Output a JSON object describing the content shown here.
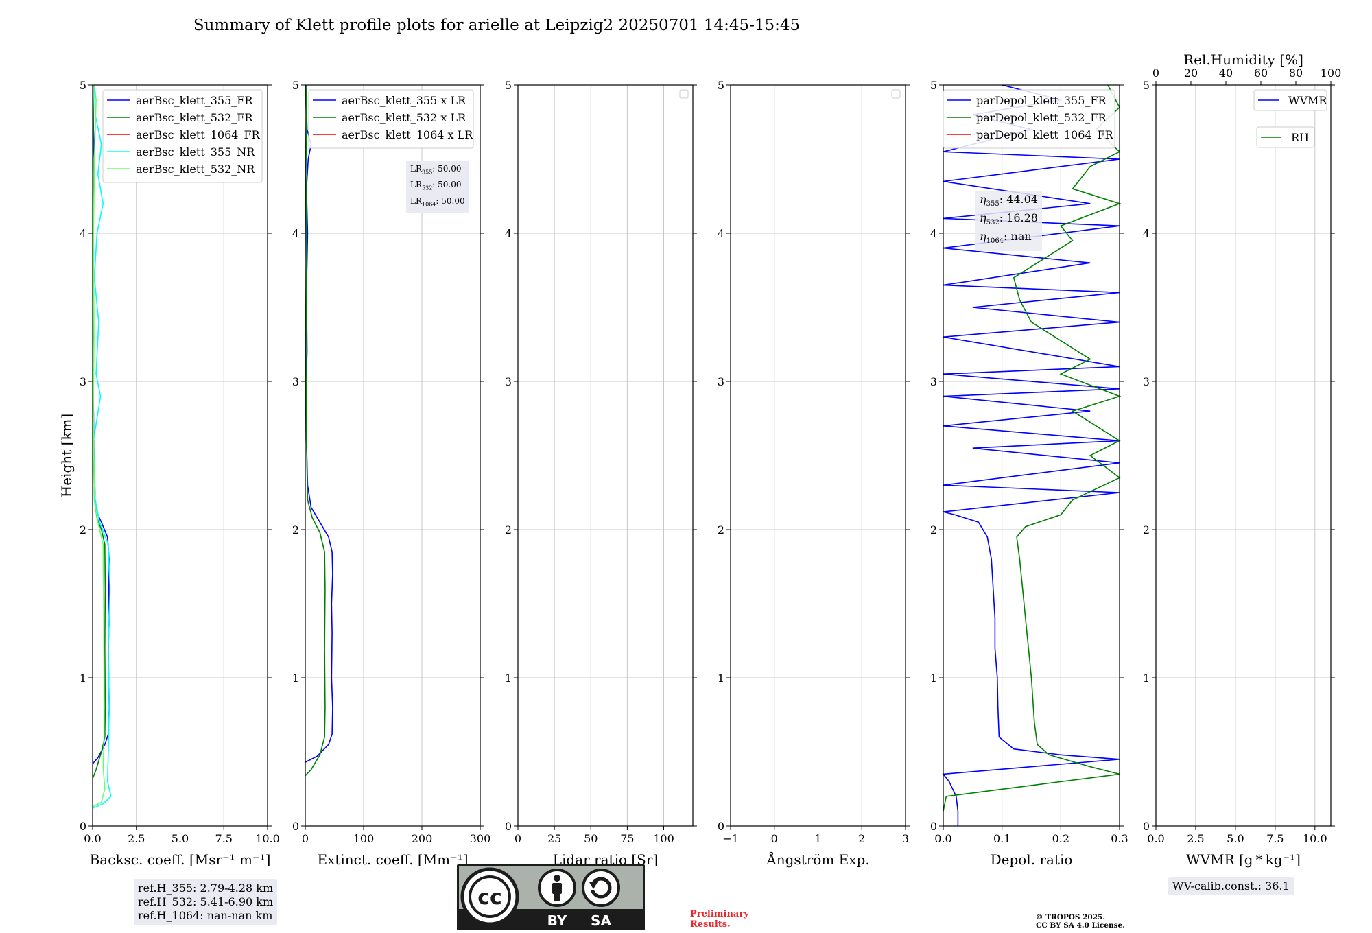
{
  "figure_title": "Summary of Klett profile plots for arielle at Leipzig2 20250701 14:45-15:45",
  "chart_data": [
    {
      "type": "line",
      "xlabel": "Backsc. coeff. [Msr⁻¹ m⁻¹]",
      "ylabel": "Height [km]",
      "xlim": [
        0,
        10
      ],
      "ylim": [
        0,
        5
      ],
      "xticks": [
        "0.0",
        "2.5",
        "5.0",
        "7.5",
        "10.0"
      ],
      "yticks": [
        "0",
        "1",
        "2",
        "3",
        "4",
        "5"
      ],
      "grid": true,
      "legend": "top-right",
      "series": [
        {
          "name": "aerBsc_klett_355_FR",
          "color": "#0000ff",
          "points": [
            [
              0.0,
              0.42
            ],
            [
              0.3,
              0.46
            ],
            [
              0.7,
              0.55
            ],
            [
              0.9,
              0.62
            ],
            [
              0.95,
              0.8
            ],
            [
              0.92,
              1.0
            ],
            [
              0.9,
              1.2
            ],
            [
              0.95,
              1.4
            ],
            [
              0.93,
              1.6
            ],
            [
              0.95,
              1.8
            ],
            [
              0.85,
              1.95
            ],
            [
              0.5,
              2.05
            ],
            [
              0.3,
              2.1
            ],
            [
              0.15,
              2.2
            ],
            [
              0.08,
              2.5
            ],
            [
              0.03,
              3.0
            ],
            [
              0.05,
              3.5
            ],
            [
              0.02,
              4.0
            ],
            [
              0.07,
              4.3
            ],
            [
              0.1,
              4.5
            ],
            [
              0.05,
              4.7
            ],
            [
              0.02,
              5.0
            ]
          ]
        },
        {
          "name": "aerBsc_klett_532_FR",
          "color": "#008000",
          "points": [
            [
              0.0,
              0.32
            ],
            [
              0.2,
              0.38
            ],
            [
              0.5,
              0.5
            ],
            [
              0.7,
              0.6
            ],
            [
              0.72,
              0.8
            ],
            [
              0.7,
              1.2
            ],
            [
              0.72,
              1.6
            ],
            [
              0.7,
              1.9
            ],
            [
              0.5,
              2.0
            ],
            [
              0.25,
              2.08
            ],
            [
              0.1,
              2.2
            ],
            [
              0.05,
              2.6
            ],
            [
              0.03,
              3.2
            ],
            [
              0.04,
              3.8
            ],
            [
              0.02,
              4.4
            ],
            [
              0.04,
              4.8
            ],
            [
              0.02,
              5.0
            ]
          ]
        },
        {
          "name": "aerBsc_klett_1064_FR",
          "color": "#ff0000",
          "points": []
        },
        {
          "name": "aerBsc_klett_355_NR",
          "color": "#00ffff",
          "points": [
            [
              0.0,
              0.12
            ],
            [
              0.6,
              0.15
            ],
            [
              1.05,
              0.2
            ],
            [
              0.85,
              0.3
            ],
            [
              0.9,
              0.5
            ],
            [
              0.95,
              0.8
            ],
            [
              0.9,
              1.2
            ],
            [
              1.0,
              1.6
            ],
            [
              0.9,
              1.9
            ],
            [
              0.4,
              2.05
            ],
            [
              0.15,
              2.2
            ],
            [
              0.05,
              2.6
            ],
            [
              0.45,
              2.9
            ],
            [
              0.2,
              3.05
            ],
            [
              0.35,
              3.4
            ],
            [
              0.1,
              3.7
            ],
            [
              0.25,
              4.0
            ],
            [
              0.6,
              4.2
            ],
            [
              0.3,
              4.4
            ],
            [
              0.5,
              4.6
            ],
            [
              0.15,
              4.8
            ],
            [
              0.1,
              5.0
            ]
          ]
        },
        {
          "name": "aerBsc_klett_532_NR",
          "color": "#66ff66",
          "points": [
            [
              0.0,
              0.13
            ],
            [
              0.5,
              0.16
            ],
            [
              0.7,
              0.25
            ],
            [
              0.6,
              0.4
            ],
            [
              0.65,
              0.6
            ],
            [
              0.65,
              1.0
            ],
            [
              0.63,
              1.5
            ],
            [
              0.6,
              1.9
            ],
            [
              0.3,
              2.05
            ],
            [
              0.1,
              2.2
            ],
            [
              0.04,
              2.8
            ],
            [
              0.08,
              3.3
            ],
            [
              0.05,
              4.0
            ],
            [
              0.1,
              4.5
            ],
            [
              0.2,
              4.9
            ],
            [
              0.1,
              5.0
            ]
          ]
        }
      ],
      "annotation": [
        "ref.H_355: 2.79-4.28 km",
        "ref.H_532: 5.41-6.90 km",
        "ref.H_1064: nan-nan km"
      ]
    },
    {
      "type": "line",
      "xlabel": "Extinct. coeff. [Mm⁻¹]",
      "xlim": [
        0,
        300
      ],
      "ylim": [
        0,
        5
      ],
      "xticks": [
        "0",
        "100",
        "200",
        "300"
      ],
      "yticks": [
        "0",
        "1",
        "2",
        "3",
        "4",
        "5"
      ],
      "grid": true,
      "legend": "top-right",
      "series": [
        {
          "name": "aerBsc_klett_355 x LR",
          "color": "#0000ff",
          "points": [
            [
              0.0,
              0.43
            ],
            [
              20,
              0.47
            ],
            [
              40,
              0.55
            ],
            [
              46,
              0.62
            ],
            [
              47,
              0.8
            ],
            [
              45,
              1.0
            ],
            [
              46,
              1.3
            ],
            [
              45,
              1.5
            ],
            [
              47,
              1.7
            ],
            [
              46,
              1.85
            ],
            [
              40,
              1.95
            ],
            [
              25,
              2.05
            ],
            [
              10,
              2.15
            ],
            [
              4,
              2.3
            ],
            [
              2,
              2.6
            ],
            [
              1,
              3.0
            ],
            [
              3,
              3.2
            ],
            [
              2,
              3.6
            ],
            [
              4,
              4.0
            ],
            [
              2,
              4.3
            ],
            [
              5,
              4.5
            ],
            [
              10,
              4.6
            ],
            [
              3,
              4.7
            ],
            [
              1,
              5.0
            ]
          ]
        },
        {
          "name": "aerBsc_klett_532 x LR",
          "color": "#008000",
          "points": [
            [
              0.0,
              0.34
            ],
            [
              10,
              0.38
            ],
            [
              25,
              0.48
            ],
            [
              33,
              0.6
            ],
            [
              34,
              0.8
            ],
            [
              33,
              1.2
            ],
            [
              34,
              1.6
            ],
            [
              33,
              1.85
            ],
            [
              25,
              1.98
            ],
            [
              12,
              2.08
            ],
            [
              4,
              2.2
            ],
            [
              2,
              2.6
            ],
            [
              1,
              3.2
            ],
            [
              2,
              3.8
            ],
            [
              1,
              4.4
            ],
            [
              2,
              4.8
            ],
            [
              1,
              5.0
            ]
          ]
        },
        {
          "name": "aerBsc_klett_1064 x LR",
          "color": "#ff0000",
          "points": []
        }
      ],
      "annotation": [
        "LR355: 50.00",
        "LR532: 50.00",
        "LR1064: 50.00"
      ]
    },
    {
      "type": "line",
      "xlabel": "Lidar ratio [Sr]",
      "xlim": [
        0,
        120
      ],
      "ylim": [
        0,
        5
      ],
      "xticks": [
        "0",
        "25",
        "50",
        "75",
        "100"
      ],
      "yticks": [
        "0",
        "1",
        "2",
        "3",
        "4",
        "5"
      ],
      "grid": true,
      "legend": "top-right",
      "series": []
    },
    {
      "type": "line",
      "xlabel": "Ångström Exp.",
      "xlim": [
        -1,
        3
      ],
      "ylim": [
        0,
        5
      ],
      "xticks": [
        "−1",
        "0",
        "1",
        "2",
        "3"
      ],
      "yticks": [
        "0",
        "1",
        "2",
        "3",
        "4",
        "5"
      ],
      "grid": true,
      "legend": "top-right",
      "series": []
    },
    {
      "type": "line",
      "xlabel": "Depol. ratio",
      "xlim": [
        0,
        0.3
      ],
      "ylim": [
        0,
        5
      ],
      "xticks": [
        "0.0",
        "0.1",
        "0.2",
        "0.3"
      ],
      "yticks": [
        "0",
        "1",
        "2",
        "3",
        "4",
        "5"
      ],
      "grid": true,
      "legend": "top-right",
      "series": [
        {
          "name": "parDepol_klett_355_FR",
          "color": "#0000ff",
          "points": [
            [
              0.025,
              0.0
            ],
            [
              0.025,
              0.1
            ],
            [
              0.022,
              0.2
            ],
            [
              0.01,
              0.3
            ],
            [
              0.0,
              0.35
            ],
            [
              0.3,
              0.45
            ],
            [
              0.2,
              0.48
            ],
            [
              0.12,
              0.52
            ],
            [
              0.095,
              0.6
            ],
            [
              0.093,
              0.8
            ],
            [
              0.092,
              1.0
            ],
            [
              0.088,
              1.2
            ],
            [
              0.088,
              1.4
            ],
            [
              0.085,
              1.6
            ],
            [
              0.082,
              1.8
            ],
            [
              0.075,
              1.95
            ],
            [
              0.06,
              2.05
            ],
            [
              0.02,
              2.1
            ],
            [
              0.0,
              2.12
            ],
            [
              0.3,
              2.25
            ],
            [
              0.0,
              2.3
            ],
            [
              0.3,
              2.45
            ],
            [
              0.05,
              2.55
            ],
            [
              0.3,
              2.6
            ],
            [
              0.0,
              2.7
            ],
            [
              0.25,
              2.8
            ],
            [
              0.0,
              2.9
            ],
            [
              0.3,
              2.95
            ],
            [
              0.0,
              3.05
            ],
            [
              0.3,
              3.1
            ],
            [
              0.0,
              3.3
            ],
            [
              0.3,
              3.4
            ],
            [
              0.05,
              3.5
            ],
            [
              0.3,
              3.6
            ],
            [
              0.0,
              3.65
            ],
            [
              0.25,
              3.8
            ],
            [
              0.0,
              3.9
            ],
            [
              0.3,
              4.05
            ],
            [
              0.0,
              4.1
            ],
            [
              0.25,
              4.2
            ],
            [
              0.0,
              4.35
            ],
            [
              0.3,
              4.5
            ],
            [
              0.0,
              4.55
            ],
            [
              0.15,
              4.7
            ],
            [
              0.05,
              4.8
            ],
            [
              0.2,
              4.9
            ],
            [
              0.1,
              5.0
            ]
          ]
        },
        {
          "name": "parDepol_klett_532_FR",
          "color": "#008000",
          "points": [
            [
              0.0,
              0.1
            ],
            [
              0.005,
              0.2
            ],
            [
              0.3,
              0.35
            ],
            [
              0.25,
              0.4
            ],
            [
              0.18,
              0.48
            ],
            [
              0.16,
              0.55
            ],
            [
              0.155,
              0.7
            ],
            [
              0.15,
              1.0
            ],
            [
              0.145,
              1.2
            ],
            [
              0.14,
              1.4
            ],
            [
              0.135,
              1.6
            ],
            [
              0.13,
              1.8
            ],
            [
              0.125,
              1.95
            ],
            [
              0.14,
              2.02
            ],
            [
              0.2,
              2.1
            ],
            [
              0.22,
              2.2
            ],
            [
              0.3,
              2.35
            ],
            [
              0.25,
              2.5
            ],
            [
              0.3,
              2.6
            ],
            [
              0.22,
              2.8
            ],
            [
              0.3,
              2.9
            ],
            [
              0.2,
              3.05
            ],
            [
              0.25,
              3.15
            ],
            [
              0.19,
              3.3
            ],
            [
              0.15,
              3.4
            ],
            [
              0.13,
              3.55
            ],
            [
              0.12,
              3.7
            ],
            [
              0.18,
              3.85
            ],
            [
              0.22,
              3.95
            ],
            [
              0.2,
              4.05
            ],
            [
              0.3,
              4.2
            ],
            [
              0.22,
              4.3
            ],
            [
              0.25,
              4.45
            ],
            [
              0.3,
              4.55
            ],
            [
              0.26,
              4.7
            ],
            [
              0.3,
              4.85
            ],
            [
              0.28,
              5.0
            ]
          ]
        },
        {
          "name": "parDepol_klett_1064_FR",
          "color": "#ff0000",
          "points": []
        }
      ],
      "annotation": [
        "η355: 44.04",
        "η532: 16.28",
        "η1064: nan"
      ]
    },
    {
      "type": "line",
      "xlabel": "WVMR [g * kg⁻¹]",
      "xlabel_top": "Rel.Humidity [%]",
      "xlim": [
        0,
        11
      ],
      "xlim_top": [
        0,
        100
      ],
      "ylim": [
        0,
        5
      ],
      "xticks": [
        "0.0",
        "2.5",
        "5.0",
        "7.5",
        "10.0"
      ],
      "xticks_top": [
        "0",
        "20",
        "40",
        "60",
        "80",
        "100"
      ],
      "yticks": [
        "0",
        "1",
        "2",
        "3",
        "4",
        "5"
      ],
      "grid": true,
      "legend": "top-right",
      "series": [
        {
          "name": "WVMR",
          "color": "#0000ff",
          "points": []
        },
        {
          "name": "RH",
          "color": "#008000",
          "points": []
        }
      ],
      "annotation": [
        "WV-calib.const.: 36.1"
      ]
    }
  ],
  "footer": {
    "license_badge": {
      "by": "BY",
      "sa": "SA"
    },
    "preliminary": [
      "Preliminary",
      "Results."
    ],
    "copyright": [
      "© TROPOS 2025.",
      "CC BY SA 4.0 License."
    ]
  }
}
